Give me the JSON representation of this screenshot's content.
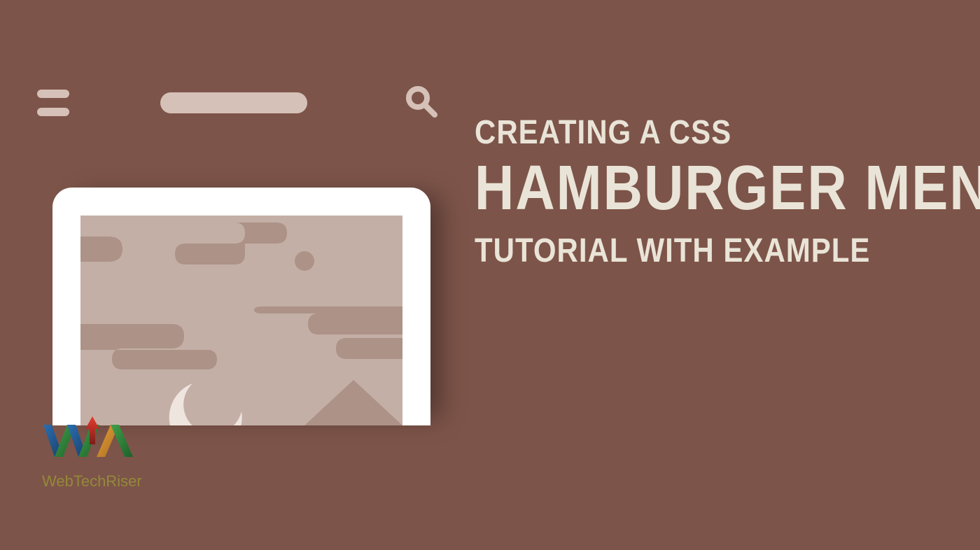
{
  "heading": {
    "line1": "CREATING A CSS",
    "line2": "HAMBURGER MENU:",
    "line3": "TUTORIAL WITH EXAMPLE"
  },
  "logo": {
    "text": "WebTechRiser"
  }
}
